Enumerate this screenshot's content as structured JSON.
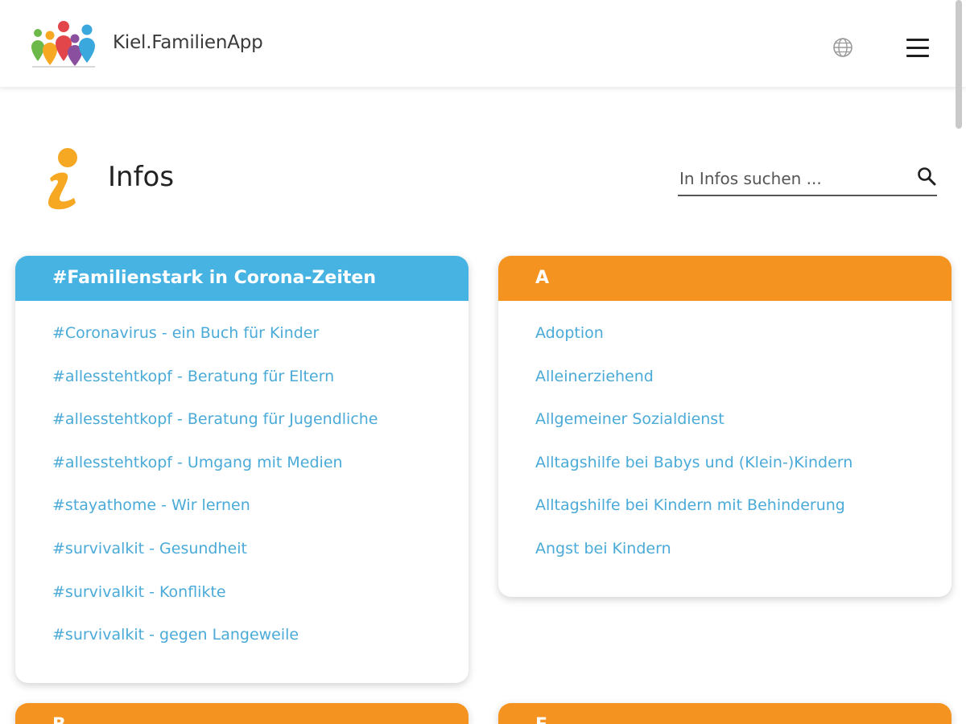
{
  "header": {
    "app_title": "Kiel.FamilienApp",
    "icons": {
      "logo": "people-logo",
      "language": "globe-icon",
      "menu": "hamburger-menu-icon"
    }
  },
  "page": {
    "title": "Infos",
    "icon": "info-icon"
  },
  "search": {
    "placeholder": "In Infos suchen ...",
    "value": "",
    "icon": "search-icon"
  },
  "colors": {
    "blue": "#46b3e3",
    "orange": "#f4931f",
    "link": "#4aaad8",
    "info_icon": "#f7a823"
  },
  "cards": [
    {
      "header": "#Familienstark in Corona-Zeiten",
      "color": "#46b3e3",
      "items": [
        "#Coronavirus - ein Buch für Kinder",
        "#allesstehtkopf - Beratung für Eltern",
        "#allesstehtkopf - Beratung für Jugendliche",
        "#allesstehtkopf - Umgang mit Medien",
        "#stayathome - Wir lernen",
        "#survivalkit - Gesundheit",
        "#survivalkit - Konflikte",
        "#survivalkit - gegen Langeweile"
      ]
    },
    {
      "header": "A",
      "color": "#f4931f",
      "items": [
        "Adoption",
        "Alleinerziehend",
        "Allgemeiner Sozialdienst",
        "Alltagshilfe bei Babys und (Klein-)Kindern",
        "Alltagshilfe bei Kindern mit Behinderung",
        "Angst bei Kindern"
      ]
    },
    {
      "header": "B",
      "color": "#f4931f",
      "items": []
    },
    {
      "header": "E",
      "color": "#f4931f",
      "items": []
    }
  ]
}
